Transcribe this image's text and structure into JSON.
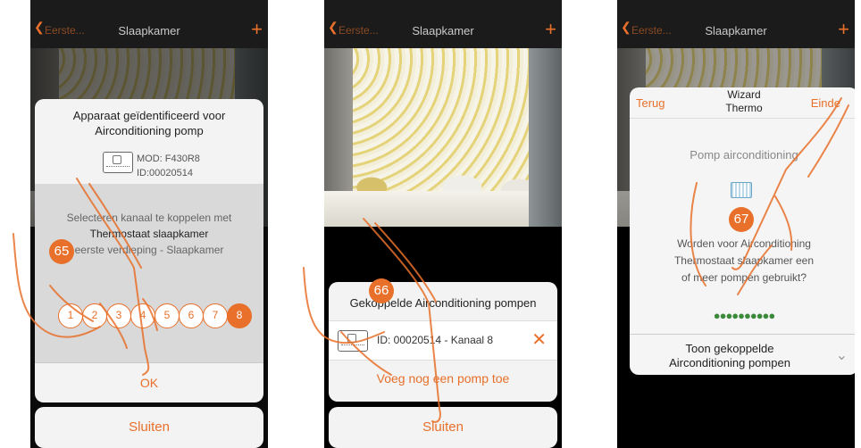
{
  "topbar": {
    "back_label": "Eerste...",
    "title": "Slaapkamer",
    "plus": "+"
  },
  "panel1": {
    "header_line1": "Apparaat geïdentificeerd voor",
    "header_line2": "Airconditioning pomp",
    "mod": "MOD: F430R8",
    "id": "ID:00020514",
    "select_text": "Selecteren kanaal te koppelen met",
    "thermostat": "Thermostaat slaapkamer",
    "floor": "eerste verdieping - Slaapkamer",
    "channels": [
      "1",
      "2",
      "3",
      "4",
      "5",
      "6",
      "7",
      "8"
    ],
    "ok": "OK",
    "close": "Sluiten",
    "step": "65"
  },
  "panel2": {
    "header": "Gekoppelde Airconditioning pompen",
    "row_text": "ID: 00020514 - Kanaal 8",
    "add": "Voeg nog een pomp toe",
    "close": "Sluiten",
    "step": "66"
  },
  "panel3": {
    "back": "Terug",
    "title_line1": "Wizard",
    "title_line2": "Thermo",
    "finish": "Einde",
    "pomp": "Pomp airconditioning",
    "question_line1": "Worden voor Airconditioning",
    "question_line2": "Thermostaat slaapkamer een",
    "question_line3": "of meer pompen gebruikt?",
    "dots": "●●●●●●●●●●",
    "show_line1": "Toon gekoppelde",
    "show_line2": "Airconditioning pompen",
    "step": "67"
  },
  "colors": {
    "accent": "#e8702a",
    "dots": "#3a8a3a"
  }
}
